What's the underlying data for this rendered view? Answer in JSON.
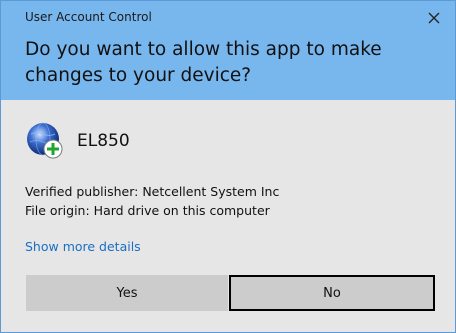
{
  "dialog": {
    "title": "User Account Control",
    "question": "Do you want to allow this app to make changes to your device?",
    "app_name": "EL850",
    "app_icon": "globe-with-plus-icon",
    "publisher": "Verified publisher: Netcellent System Inc",
    "origin": "File origin: Hard drive on this computer",
    "more_details": "Show more details",
    "yes_label": "Yes",
    "no_label": "No"
  },
  "colors": {
    "header": "#78b6ee",
    "body": "#e6e6e6",
    "link": "#1a6fc4",
    "button": "#cccccc"
  }
}
